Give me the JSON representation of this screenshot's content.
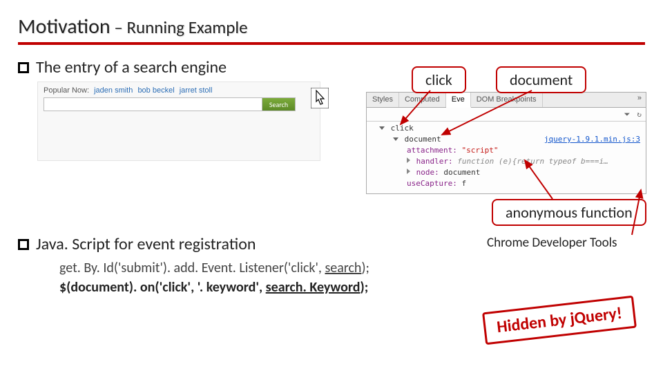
{
  "title": {
    "main": "Motivation",
    "sub": " – Running Example"
  },
  "bullets": {
    "entry": "The entry of a search engine",
    "js": "Java. Script for event registration"
  },
  "search": {
    "popular_label": "Popular Now:",
    "links": [
      "jaden smith",
      "bob beckel",
      "jarret stoll"
    ],
    "button": "Search",
    "placeholder": ""
  },
  "devtools": {
    "tabs": [
      "Styles",
      "Computed",
      "Eve",
      "DOM Breakpoints"
    ],
    "overflow": "»",
    "filter_glyph": "⏷",
    "refresh_glyph": "↻",
    "tree": {
      "root": "click",
      "doc": "document",
      "jq_link": "jquery-1.9.1.min.js:3",
      "attachment_key": "attachment:",
      "attachment_val": "\"script\"",
      "handler_key": "handler:",
      "handler_val": "function (e){return typeof b===i…",
      "node_key": "node:",
      "node_val": "document",
      "capture_key": "useCapture:",
      "capture_val": "f"
    }
  },
  "callouts": {
    "click": "click",
    "document": "document",
    "anon": "anonymous function",
    "caption": "Chrome Developer Tools",
    "stamp": "Hidden by jQuery!"
  },
  "code": {
    "l1a": "get. By. Id('submit'). add. Event. Listener('click', ",
    "l1b": "search",
    "l1c": ");",
    "l2a": "$(document). on('click', '. keyword', ",
    "l2b": "search. Keyword",
    "l2c": ");"
  }
}
